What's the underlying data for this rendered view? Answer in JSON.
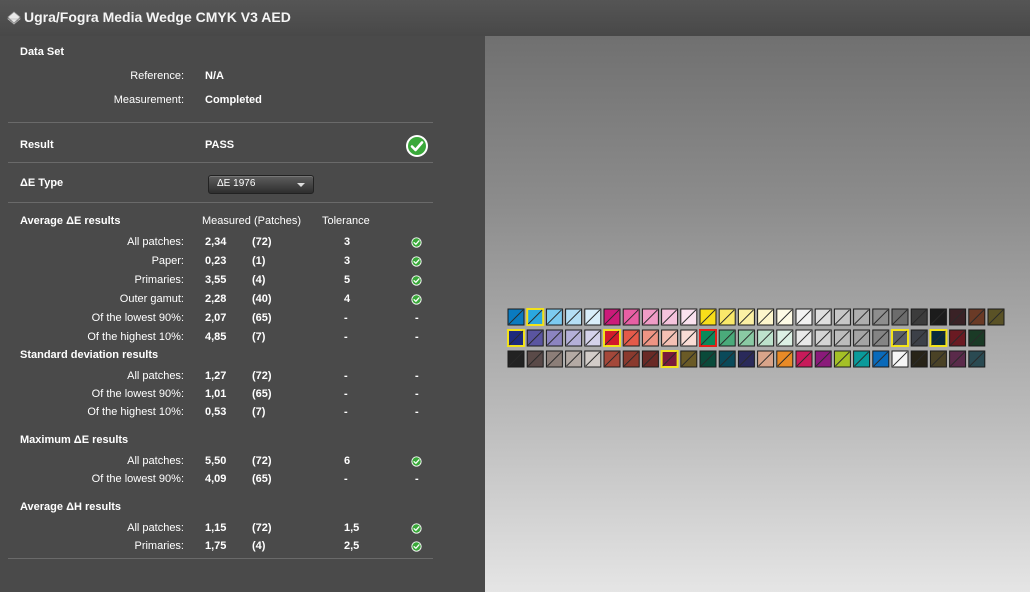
{
  "window": {
    "title": "Ugra/Fogra Media Wedge CMYK V3 AED",
    "icon": "wedge-document-icon"
  },
  "dataset": {
    "header": "Data Set",
    "reference_label": "Reference:",
    "reference_value": "N/A",
    "measurement_label": "Measurement:",
    "measurement_value": "Completed"
  },
  "result": {
    "label": "Result",
    "value": "PASS",
    "icon": "pass-check-icon"
  },
  "de_type": {
    "label": "ΔE Type",
    "selected": "ΔE 1976"
  },
  "average": {
    "header": "Average ΔE results",
    "col_measured": "Measured (Patches)",
    "col_tolerance": "Tolerance",
    "rows": [
      {
        "label": "All patches:",
        "value": "2,34",
        "patches": "(72)",
        "tolerance": "3",
        "status": "ok"
      },
      {
        "label": "Paper:",
        "value": "0,23",
        "patches": "(1)",
        "tolerance": "3",
        "status": "ok"
      },
      {
        "label": "Primaries:",
        "value": "3,55",
        "patches": "(4)",
        "tolerance": "5",
        "status": "ok"
      },
      {
        "label": "Outer gamut:",
        "value": "2,28",
        "patches": "(40)",
        "tolerance": "4",
        "status": "ok"
      },
      {
        "label": "Of the lowest 90%:",
        "value": "2,07",
        "patches": "(65)",
        "tolerance": "-",
        "status": "-"
      },
      {
        "label": "Of the highest 10%:",
        "value": "4,85",
        "patches": "(7)",
        "tolerance": "-",
        "status": "-"
      }
    ]
  },
  "stddev": {
    "header": "Standard deviation results",
    "rows": [
      {
        "label": "All patches:",
        "value": "1,27",
        "patches": "(72)",
        "tolerance": "-",
        "status": "-"
      },
      {
        "label": "Of the lowest 90%:",
        "value": "1,01",
        "patches": "(65)",
        "tolerance": "-",
        "status": "-"
      },
      {
        "label": "Of the highest 10%:",
        "value": "0,53",
        "patches": "(7)",
        "tolerance": "-",
        "status": "-"
      }
    ]
  },
  "maximum": {
    "header": "Maximum ΔE results",
    "rows": [
      {
        "label": "All patches:",
        "value": "5,50",
        "patches": "(72)",
        "tolerance": "6",
        "status": "ok"
      },
      {
        "label": "Of the lowest 90%:",
        "value": "4,09",
        "patches": "(65)",
        "tolerance": "-",
        "status": "-"
      }
    ]
  },
  "avg_dh": {
    "header": "Average ΔH results",
    "rows": [
      {
        "label": "All patches:",
        "value": "1,15",
        "patches": "(72)",
        "tolerance": "1,5",
        "status": "ok"
      },
      {
        "label": "Primaries:",
        "value": "1,75",
        "patches": "(4)",
        "tolerance": "2,5",
        "status": "ok"
      }
    ]
  },
  "colors": {
    "pass": "#3aa83a",
    "highlight_yellow": "#f2e21a",
    "highlight_red": "#e0201a"
  },
  "wedge": {
    "rows": [
      [
        {
          "c": "#0a7bc0",
          "h": ""
        },
        {
          "c": "#2aa8df",
          "h": "yellow"
        },
        {
          "c": "#7ccaf0",
          "h": ""
        },
        {
          "c": "#b4def4",
          "h": ""
        },
        {
          "c": "#d9eefa",
          "h": ""
        },
        {
          "c": "#cc1a7a",
          "h": ""
        },
        {
          "c": "#e85fa4",
          "h": ""
        },
        {
          "c": "#f09cc6",
          "h": ""
        },
        {
          "c": "#f5c3dc",
          "h": ""
        },
        {
          "c": "#fae1ee",
          "h": ""
        },
        {
          "c": "#f8de1a",
          "h": ""
        },
        {
          "c": "#fae86a",
          "h": ""
        },
        {
          "c": "#fcf0a4",
          "h": ""
        },
        {
          "c": "#fdf6cc",
          "h": ""
        },
        {
          "c": "#fefbe6",
          "h": ""
        },
        {
          "c": "#f2f2f2",
          "h": ""
        },
        {
          "c": "#dedede",
          "h": ""
        },
        {
          "c": "#c6c6c6",
          "h": ""
        },
        {
          "c": "#aeaeae",
          "h": ""
        },
        {
          "c": "#8e8e8e",
          "h": ""
        },
        {
          "c": "#6c6c6c",
          "h": ""
        },
        {
          "c": "#3c3c3c",
          "h": ""
        },
        {
          "c": "#1c1c1c",
          "h": ""
        },
        {
          "c": "#3a2226",
          "h": ""
        },
        {
          "c": "#6a3a26",
          "h": ""
        },
        {
          "c": "#5a5226",
          "h": ""
        }
      ],
      [
        {
          "c": "#1e2a7c",
          "h": "yellow"
        },
        {
          "c": "#5a55a0",
          "h": ""
        },
        {
          "c": "#8c84c0",
          "h": ""
        },
        {
          "c": "#b4b0d8",
          "h": ""
        },
        {
          "c": "#d4d2ea",
          "h": ""
        },
        {
          "c": "#d21a2a",
          "h": "yellow"
        },
        {
          "c": "#e45a4a",
          "h": ""
        },
        {
          "c": "#ee9484",
          "h": ""
        },
        {
          "c": "#f4c0b4",
          "h": ""
        },
        {
          "c": "#f9dcd4",
          "h": ""
        },
        {
          "c": "#0a8a5a",
          "h": "red"
        },
        {
          "c": "#4aaa7a",
          "h": ""
        },
        {
          "c": "#8acaa4",
          "h": ""
        },
        {
          "c": "#bde2cc",
          "h": ""
        },
        {
          "c": "#dcf0e4",
          "h": ""
        },
        {
          "c": "#e8e8e8",
          "h": ""
        },
        {
          "c": "#d4d4d4",
          "h": ""
        },
        {
          "c": "#bcbcbc",
          "h": ""
        },
        {
          "c": "#a4a4a4",
          "h": ""
        },
        {
          "c": "#848484",
          "h": ""
        },
        {
          "c": "#5a5e66",
          "h": "yellow"
        },
        {
          "c": "#3c4048",
          "h": ""
        },
        {
          "c": "#0a2a3c",
          "h": "yellow"
        },
        {
          "c": "#6a1a22",
          "h": ""
        },
        {
          "c": "#1a3a26",
          "h": ""
        }
      ],
      [
        {
          "c": "#222222",
          "h": ""
        },
        {
          "c": "#5a4a48",
          "h": ""
        },
        {
          "c": "#8c7e78",
          "h": ""
        },
        {
          "c": "#b4aaa4",
          "h": ""
        },
        {
          "c": "#d2ccc8",
          "h": ""
        },
        {
          "c": "#a4483a",
          "h": ""
        },
        {
          "c": "#8a3a2e",
          "h": ""
        },
        {
          "c": "#6a2a26",
          "h": ""
        },
        {
          "c": "#7a1a3a",
          "h": "yellow"
        },
        {
          "c": "#6a5a26",
          "h": ""
        },
        {
          "c": "#0a4a3a",
          "h": ""
        },
        {
          "c": "#0a4a5a",
          "h": ""
        },
        {
          "c": "#2a2a5a",
          "h": ""
        },
        {
          "c": "#d8a48a",
          "h": ""
        },
        {
          "c": "#e88a26",
          "h": ""
        },
        {
          "c": "#c81a5a",
          "h": ""
        },
        {
          "c": "#8a1a7a",
          "h": ""
        },
        {
          "c": "#a4c026",
          "h": ""
        },
        {
          "c": "#0a9a9a",
          "h": ""
        },
        {
          "c": "#0a6aba",
          "h": ""
        },
        {
          "c": "#f6f6f6",
          "h": ""
        },
        {
          "c": "#282418",
          "h": ""
        },
        {
          "c": "#4a4226",
          "h": ""
        },
        {
          "c": "#5a2a4a",
          "h": ""
        },
        {
          "c": "#2a4a52",
          "h": ""
        }
      ]
    ]
  }
}
